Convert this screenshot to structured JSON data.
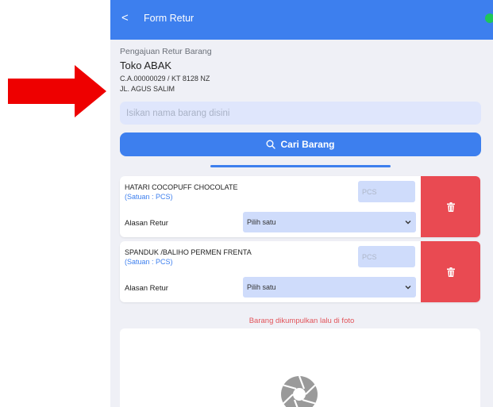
{
  "header": {
    "back_glyph": "<",
    "title": "Form Retur"
  },
  "form": {
    "subtitle": "Pengajuan Retur Barang",
    "store_name": "Toko ABAK",
    "store_code": "C.A.00000029 / KT 8128 NZ",
    "address": "JL. AGUS SALIM"
  },
  "search": {
    "placeholder": "Isikan nama barang disini",
    "button_label": "Cari Barang"
  },
  "items": [
    {
      "name": "HATARI COCOPUFF CHOCOLATE",
      "unit": "(Satuan : PCS)",
      "qty_placeholder": "PCS",
      "reason_label": "Alasan Retur",
      "reason_value": "Pilih satu"
    },
    {
      "name": "SPANDUK /BALIHO PERMEN FRENTA",
      "unit": "(Satuan : PCS)",
      "qty_placeholder": "PCS",
      "reason_label": "Alasan Retur",
      "reason_value": "Pilih satu"
    }
  ],
  "photo_note": "Barang dikumpulkan lalu di foto",
  "colors": {
    "primary": "#3d7fee",
    "danger": "#e94a52",
    "annotation_arrow": "#ee0000",
    "status_dot": "#1ec758"
  },
  "icons": [
    "back-chevron-icon",
    "search-icon",
    "trash-icon",
    "chevron-down-icon",
    "camera-aperture-icon",
    "red-arrow-annotation"
  ]
}
